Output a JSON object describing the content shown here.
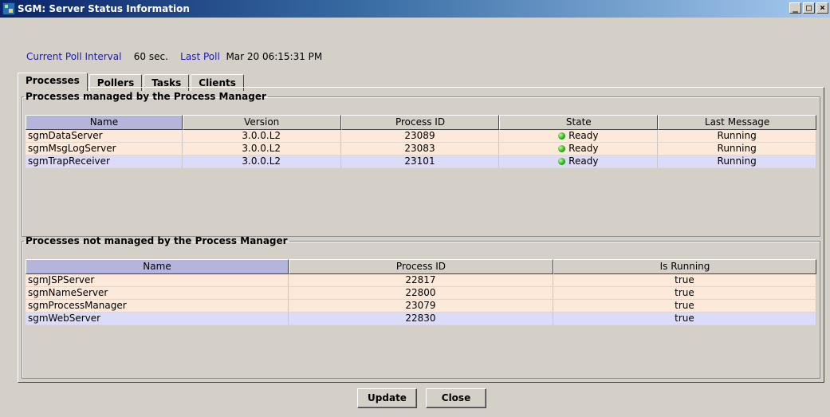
{
  "window": {
    "title": "SGM: Server Status Information",
    "controls": [
      "_",
      "□",
      "×"
    ]
  },
  "poll": {
    "interval_label": "Current Poll Interval",
    "interval_value": "60 sec.",
    "last_label": "Last Poll",
    "last_value": "Mar 20  06:15:31 PM"
  },
  "tabs": [
    {
      "label": "Processes",
      "active": true
    },
    {
      "label": "Pollers",
      "active": false
    },
    {
      "label": "Tasks",
      "active": false
    },
    {
      "label": "Clients",
      "active": false
    }
  ],
  "managed": {
    "title": "Processes managed by the Process Manager",
    "columns": [
      "Name",
      "Version",
      "Process ID",
      "State",
      "Last Message"
    ],
    "rows": [
      [
        "sgmDataServer",
        "3.0.0.L2",
        "23089",
        "Ready",
        "Running"
      ],
      [
        "sgmMsgLogServer",
        "3.0.0.L2",
        "23083",
        "Ready",
        "Running"
      ],
      [
        "sgmTrapReceiver",
        "3.0.0.L2",
        "23101",
        "Ready",
        "Running"
      ]
    ],
    "status_color": "#30b020"
  },
  "unmanaged": {
    "title": "Processes not managed by the Process Manager",
    "columns": [
      "Name",
      "Process ID",
      "Is Running"
    ],
    "rows": [
      [
        "sgmJSPServer",
        "22817",
        "true"
      ],
      [
        "sgmNameServer",
        "22800",
        "true"
      ],
      [
        "sgmProcessManager",
        "23079",
        "true"
      ],
      [
        "sgmWebServer",
        "22830",
        "true"
      ]
    ]
  },
  "buttons": {
    "update": "Update",
    "close": "Close"
  }
}
